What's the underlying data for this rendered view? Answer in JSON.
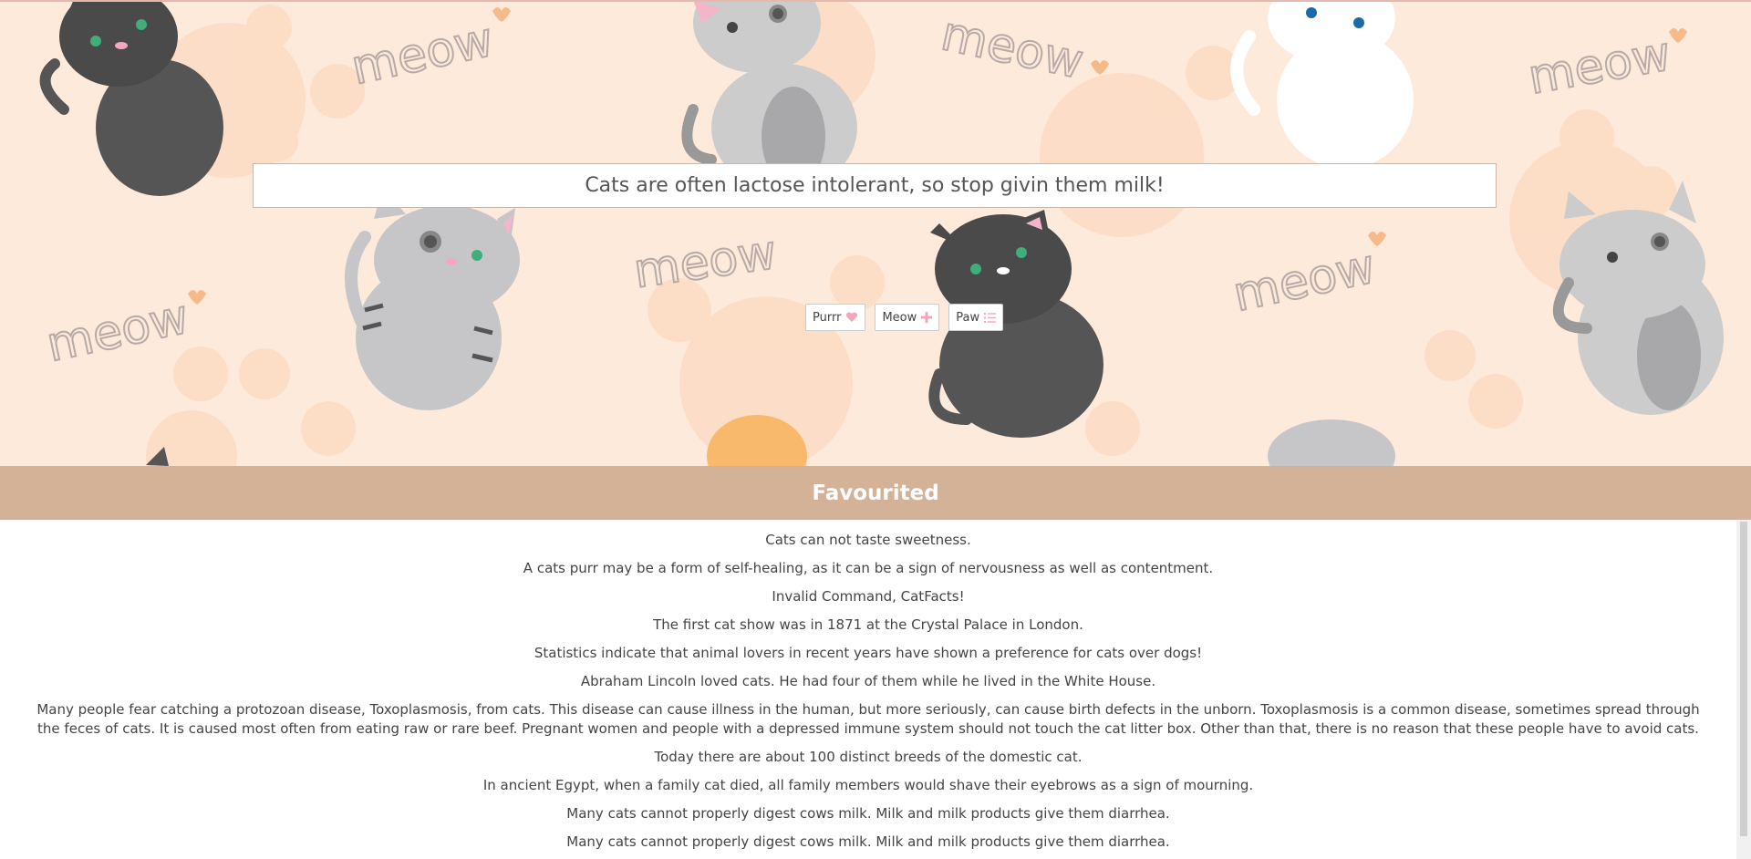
{
  "hero": {
    "fact_text": "Cats are often lactose intolerant, so stop givin them milk!",
    "wallpaper_words": [
      "meow",
      "meow",
      "meow",
      "meow",
      "meow",
      "meow",
      "meow"
    ]
  },
  "buttons": [
    {
      "label": "Purrr",
      "icon": "heart-icon"
    },
    {
      "label": "Meow",
      "icon": "plus-icon"
    },
    {
      "label": "Paw",
      "icon": "list-icon"
    }
  ],
  "favourited": {
    "title": "Favourited",
    "items": [
      "Cats can not taste sweetness.",
      "A cats purr may be a form of self-healing, as it can be a sign of nervousness as well as contentment.",
      "Invalid Command, CatFacts!",
      "The first cat show was in 1871 at the Crystal Palace in London.",
      "Statistics indicate that animal lovers in recent years have shown a preference for cats over dogs!",
      "Abraham Lincoln loved cats. He had four of them while he lived in the White House.",
      "Many people fear catching a protozoan disease, Toxoplasmosis, from cats. This disease can cause illness in the human, but more seriously, can cause birth defects in the unborn. Toxoplasmosis is a common disease, sometimes spread through the feces of cats. It is caused most often from eating raw or rare beef. Pregnant women and people with a depressed immune system should not touch the cat litter box. Other than that, there is no reason that these people have to avoid cats.",
      "Today there are about 100 distinct breeds of the domestic cat.",
      "In ancient Egypt, when a family cat died, all family members would shave their eyebrows as a sign of mourning.",
      "Many cats cannot properly digest cows milk. Milk and milk products give them diarrhea.",
      "Many cats cannot properly digest cows milk. Milk and milk products give them diarrhea."
    ]
  },
  "colors": {
    "hero_bg": "#feeadb",
    "header_bg": "#d4b298",
    "accent_pink": "#f2a7b8"
  }
}
